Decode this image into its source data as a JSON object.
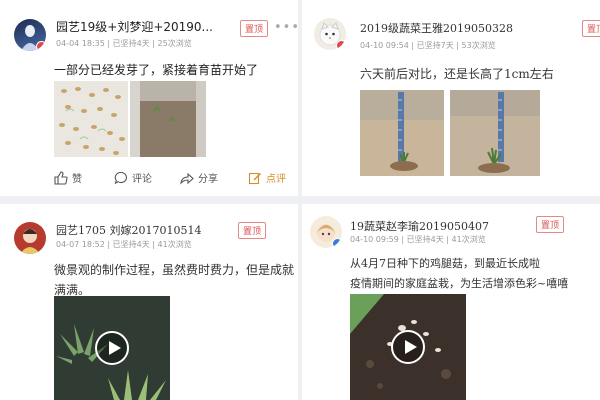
{
  "posts": [
    {
      "author": "园艺19级+刘梦迎+20190...",
      "date": "04-04 18:35",
      "status": "已坚持4天",
      "views": "25次浏览",
      "tag": "置顶",
      "content": "一部分已经发芽了，紧接着育苗开始了",
      "actions": {
        "like": "赞",
        "comment": "评论",
        "share": "分享",
        "review": "点评"
      }
    },
    {
      "author": "2019级蔬菜王雅2019050328",
      "date": "04-10 09:54",
      "status": "已坚持7天",
      "views": "53次浏览",
      "tag": "置顶",
      "content": "六天前后对比，还是长高了1cm左右"
    },
    {
      "author": "园艺1705 刘嫁2017010514",
      "date": "04-07 18:52",
      "status": "已坚持4天",
      "views": "41次浏览",
      "tag": "置顶",
      "content_lines": [
        "微景观的制作过程，虽然费时费力，但是成就",
        "满满。"
      ]
    },
    {
      "author": "19蔬菜赵李瑜2019050407",
      "date": "04-10 09:59",
      "status": "已坚持4天",
      "views": "41次浏览",
      "tag": "置顶",
      "content_lines": [
        "从4月7日种下的鸡腿菇，到最近长成啦",
        "疫情期间的家庭盆栽，为生活增添色彩~嘻嘻"
      ]
    }
  ],
  "icons": {
    "more": "more-dots-icon",
    "like": "thumb-up-icon",
    "comment": "comment-bubble-icon",
    "share": "share-arrow-icon",
    "review": "edit-review-icon"
  },
  "colors": {
    "tag_red": "#d9534f",
    "highlight_orange": "#d98b2b",
    "background": "#eef0f3"
  }
}
